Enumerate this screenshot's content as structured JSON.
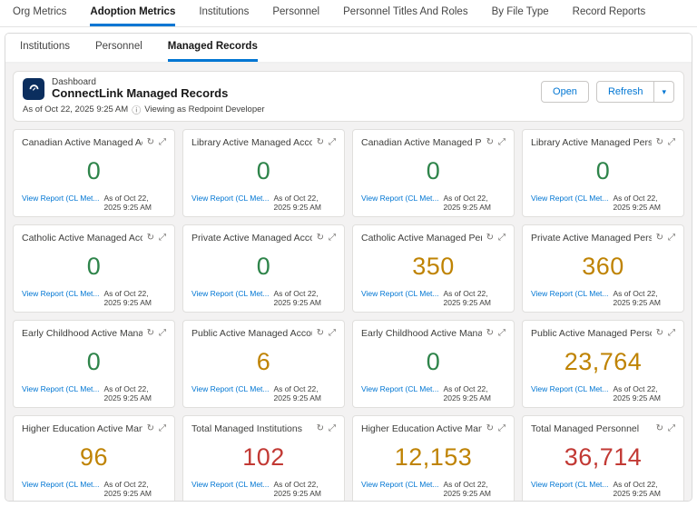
{
  "colors": {
    "green": "#2e844a",
    "orange": "#bf8303",
    "red": "#c23934",
    "link": "#0176d3"
  },
  "top_nav": {
    "tabs": [
      {
        "label": "Org Metrics",
        "active": false
      },
      {
        "label": "Adoption Metrics",
        "active": true
      },
      {
        "label": "Institutions",
        "active": false
      },
      {
        "label": "Personnel",
        "active": false
      },
      {
        "label": "Personnel Titles And Roles",
        "active": false
      },
      {
        "label": "By File Type",
        "active": false
      },
      {
        "label": "Record Reports",
        "active": false
      }
    ]
  },
  "sub_nav": {
    "tabs": [
      {
        "label": "Institutions",
        "active": false
      },
      {
        "label": "Personnel",
        "active": false
      },
      {
        "label": "Managed Records",
        "active": true
      }
    ]
  },
  "dashboard": {
    "entity_label": "Dashboard",
    "title": "ConnectLink Managed Records",
    "as_of": "As of Oct 22, 2025 9:25 AM",
    "info_icon": "ⓘ",
    "viewing_as": "Viewing as Redpoint Developer",
    "open_button": "Open",
    "refresh_button": "Refresh",
    "dropdown_icon": "▾"
  },
  "card_icons": {
    "refresh": "↻",
    "expand": "⤢"
  },
  "card_footer": {
    "link_label": "View Report (CL Met...",
    "as_of": "As of Oct 22, 2025 9:25 AM"
  },
  "cards": [
    {
      "title": "Canadian Active Managed Acc...",
      "value": "0",
      "color": "green"
    },
    {
      "title": "Library Active Managed Accounts",
      "value": "0",
      "color": "green"
    },
    {
      "title": "Canadian Active Managed Pers...",
      "value": "0",
      "color": "green"
    },
    {
      "title": "Library Active Managed Person...",
      "value": "0",
      "color": "green"
    },
    {
      "title": "Catholic Active Managed Accou...",
      "value": "0",
      "color": "green"
    },
    {
      "title": "Private Active Managed Accounts",
      "value": "0",
      "color": "green"
    },
    {
      "title": "Catholic Active Managed Perso...",
      "value": "350",
      "color": "orange"
    },
    {
      "title": "Private Active Managed Person...",
      "value": "360",
      "color": "orange"
    },
    {
      "title": "Early Childhood Active Manage...",
      "value": "0",
      "color": "green"
    },
    {
      "title": "Public Active Managed Accounts",
      "value": "6",
      "color": "orange"
    },
    {
      "title": "Early Childhood Active Manage...",
      "value": "0",
      "color": "green"
    },
    {
      "title": "Public Active Managed Personnel",
      "value": "23,764",
      "color": "orange"
    },
    {
      "title": "Higher Education Active Manag...",
      "value": "96",
      "color": "orange"
    },
    {
      "title": "Total Managed Institutions",
      "value": "102",
      "color": "red"
    },
    {
      "title": "Higher Education Active Manag...",
      "value": "12,153",
      "color": "orange"
    },
    {
      "title": "Total Managed Personnel",
      "value": "36,714",
      "color": "red"
    }
  ]
}
